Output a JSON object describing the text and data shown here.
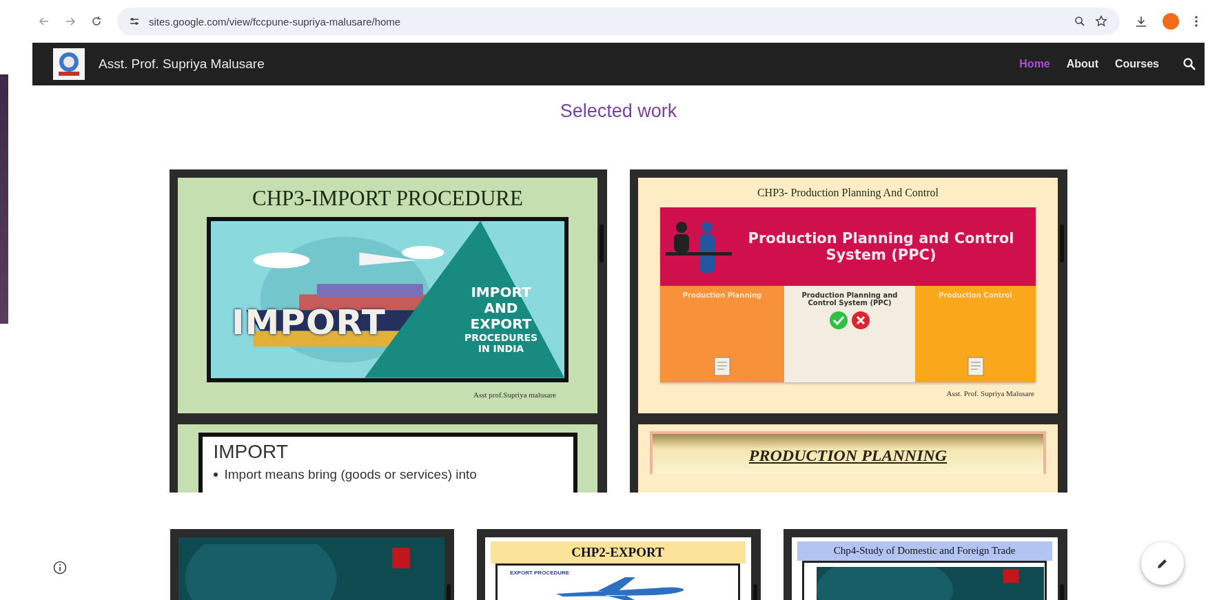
{
  "browser": {
    "url": "sites.google.com/view/fccpune-supriya-malusare/home"
  },
  "site": {
    "title": "Asst. Prof. Supriya Malusare",
    "nav": [
      {
        "label": "Home",
        "selected": true
      },
      {
        "label": "About",
        "selected": false
      },
      {
        "label": "Courses",
        "selected": false
      }
    ]
  },
  "section_title": "Selected work",
  "documents": [
    {
      "slides": [
        {
          "kind": "banner",
          "color": "#c5dfb0",
          "title": "CHP3-IMPORT PROCEDURE",
          "banner_word": "IMPORT",
          "banner_caption": [
            "IMPORT AND",
            "EXPORT",
            "PROCEDURES",
            "IN INDIA"
          ],
          "author": "Asst prof.Supriya malusare"
        },
        {
          "kind": "bullets",
          "color": "#c5dfb0",
          "heading": "IMPORT",
          "bullet": "Import means bring (goods or services) into"
        }
      ]
    },
    {
      "slides": [
        {
          "kind": "infographic",
          "color": "#fdecc4",
          "title": "CHP3- Production Planning And Control",
          "headline": "Production Planning and Control System (PPC)",
          "columns": [
            "Production Planning",
            "Production Planning and Control System (PPC)",
            "Production Control"
          ],
          "author": "Asst. Prof. Supriya Malusare"
        },
        {
          "kind": "heading",
          "color": "#fdecc4",
          "heading": "PRODUCTION PLANNING"
        }
      ]
    },
    {
      "slides": [
        {
          "kind": "picture",
          "color": "#0f4a50"
        }
      ]
    },
    {
      "slides": [
        {
          "kind": "topbar",
          "color": "#fbe49a",
          "title": "CHP2-EXPORT",
          "subtitle": "EXPORT PROCEDURE"
        }
      ]
    },
    {
      "slides": [
        {
          "kind": "topbar",
          "color": "#b4c4f2",
          "title": "Chp4-Study of Domestic and Foreign Trade"
        }
      ]
    }
  ]
}
